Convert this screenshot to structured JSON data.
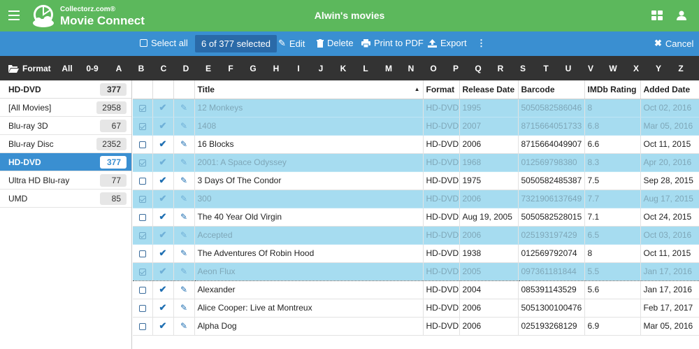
{
  "header": {
    "logo_small": "Collectorz.com®",
    "logo_big": "Movie Connect",
    "title": "Alwin's movies"
  },
  "actions": {
    "select_all": "Select all",
    "selected": "6 of 377 selected",
    "edit": "Edit",
    "delete": "Delete",
    "print": "Print to PDF",
    "export": "Export",
    "cancel": "Cancel"
  },
  "alpha": {
    "format": "Format",
    "letters": [
      "All",
      "0-9",
      "A",
      "B",
      "C",
      "D",
      "E",
      "F",
      "G",
      "H",
      "I",
      "J",
      "K",
      "L",
      "M",
      "N",
      "O",
      "P",
      "Q",
      "R",
      "S",
      "T",
      "U",
      "V",
      "W",
      "X",
      "Y",
      "Z"
    ]
  },
  "sidebar": {
    "header": {
      "label": "HD-DVD",
      "count": "377"
    },
    "items": [
      {
        "label": "[All Movies]",
        "count": "2958"
      },
      {
        "label": "Blu-ray 3D",
        "count": "67"
      },
      {
        "label": "Blu-ray Disc",
        "count": "2352"
      },
      {
        "label": "HD-DVD",
        "count": "377"
      },
      {
        "label": "Ultra HD Blu-ray",
        "count": "77"
      },
      {
        "label": "UMD",
        "count": "85"
      }
    ]
  },
  "table": {
    "columns": [
      "Title",
      "Format",
      "Release Date",
      "Barcode",
      "IMDb Rating",
      "Added Date"
    ],
    "rows": [
      {
        "title": "12 Monkeys",
        "format": "HD-DVD",
        "release": "1995",
        "barcode": "5050582586046",
        "rating": "8",
        "added": "Oct 02, 2016"
      },
      {
        "title": "1408",
        "format": "HD-DVD",
        "release": "2007",
        "barcode": "8715664051733",
        "rating": "6.8",
        "added": "Mar 05, 2016"
      },
      {
        "title": "16 Blocks",
        "format": "HD-DVD",
        "release": "2006",
        "barcode": "8715664049907",
        "rating": "6.6",
        "added": "Oct 11, 2015"
      },
      {
        "title": "2001: A Space Odyssey",
        "format": "HD-DVD",
        "release": "1968",
        "barcode": "012569798380",
        "rating": "8.3",
        "added": "Apr 20, 2016"
      },
      {
        "title": "3 Days Of The Condor",
        "format": "HD-DVD",
        "release": "1975",
        "barcode": "5050582485387",
        "rating": "7.5",
        "added": "Sep 28, 2015"
      },
      {
        "title": "300",
        "format": "HD-DVD",
        "release": "2006",
        "barcode": "7321906137649",
        "rating": "7.7",
        "added": "Aug 17, 2015"
      },
      {
        "title": "The 40 Year Old Virgin",
        "format": "HD-DVD",
        "release": "Aug 19, 2005",
        "barcode": "5050582528015",
        "rating": "7.1",
        "added": "Oct 24, 2015"
      },
      {
        "title": "Accepted",
        "format": "HD-DVD",
        "release": "2006",
        "barcode": "025193197429",
        "rating": "6.5",
        "added": "Oct 03, 2016"
      },
      {
        "title": "The Adventures Of Robin Hood",
        "format": "HD-DVD",
        "release": "1938",
        "barcode": "012569792074",
        "rating": "8",
        "added": "Oct 11, 2015"
      },
      {
        "title": "Aeon Flux",
        "format": "HD-DVD",
        "release": "2005",
        "barcode": "097361181844",
        "rating": "5.5",
        "added": "Jan 17, 2016"
      },
      {
        "title": "Alexander",
        "format": "HD-DVD",
        "release": "2004",
        "barcode": "085391143529",
        "rating": "5.6",
        "added": "Jan 17, 2016"
      },
      {
        "title": "Alice Cooper: Live at Montreux",
        "format": "HD-DVD",
        "release": "2006",
        "barcode": "5051300100476",
        "rating": "",
        "added": "Feb 17, 2017"
      },
      {
        "title": "Alpha Dog",
        "format": "HD-DVD",
        "release": "2006",
        "barcode": "025193268129",
        "rating": "6.9",
        "added": "Mar 05, 2016"
      }
    ],
    "selected_rows": [
      0,
      1,
      3,
      5,
      7,
      9
    ]
  },
  "colors": {
    "topbar": "#5cb85c",
    "actionbar": "#3a8fd1",
    "azbar": "#333333",
    "selected_row": "#a6dcf0"
  }
}
